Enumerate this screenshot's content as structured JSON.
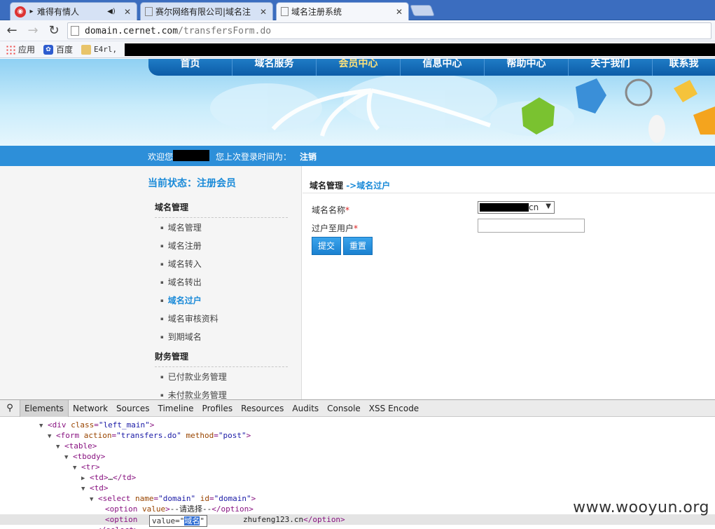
{
  "browser": {
    "tabs": [
      {
        "label": "难得有情人",
        "active": false
      },
      {
        "label": "赛尔网络有限公司|域名注",
        "active": false
      },
      {
        "label": "域名注册系统",
        "active": true
      }
    ],
    "url_host": "domain.cernet.com",
    "url_path": "/transfersForm.do",
    "bookmarks": [
      "应用",
      "百度",
      "E4rl,"
    ]
  },
  "site": {
    "nav": [
      "首页",
      "域名服务",
      "会员中心",
      "信息中心",
      "帮助中心",
      "关于我们",
      "联系我"
    ],
    "welcome_prefix": "欢迎您",
    "last_login": "您上次登录时间为：",
    "logout": "注销",
    "status": "当前状态：注册会员",
    "sidebar": {
      "section1": "域名管理",
      "items1": [
        "域名管理",
        "域名注册",
        "域名转入",
        "域名转出",
        "域名过户",
        "域名审核资料",
        "到期域名"
      ],
      "section2": "财务管理",
      "items2": [
        "已付款业务管理",
        "未付款业务管理"
      ]
    },
    "breadcrumb": {
      "parent": "域名管理",
      "arrow": " ->",
      "current": "域名过户"
    },
    "form": {
      "domain_label": "域名名称",
      "domain_value_suffix": "cn",
      "to_user_label": "过户至用户",
      "required_mark": "*",
      "submit": "提交",
      "reset": "重置"
    }
  },
  "devtools": {
    "tabs": [
      "Elements",
      "Network",
      "Sources",
      "Timeline",
      "Profiles",
      "Resources",
      "Audits",
      "Console",
      "XSS Encode"
    ],
    "tooltip_prefix": "value=\"",
    "tooltip_selected": "域名",
    "tooltip_suffix": "\"",
    "option2_tail": "zhufeng123.cn"
  },
  "watermark": "www.wooyun.org"
}
